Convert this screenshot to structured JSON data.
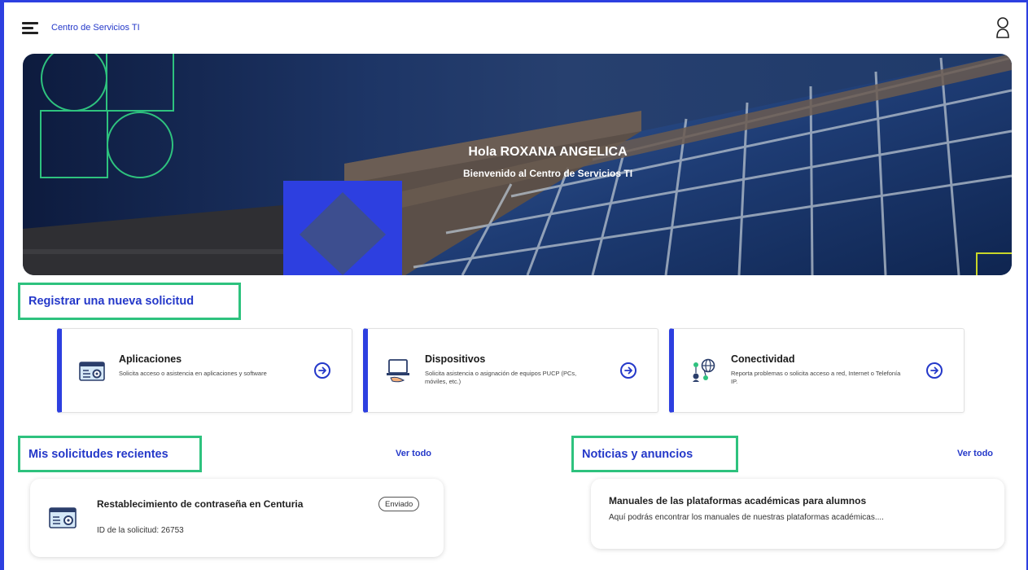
{
  "header": {
    "app_title": "Centro de Servicios TI"
  },
  "hero": {
    "greeting": "Hola ROXANA ANGELICA",
    "subtitle": "Bienvenido al Centro de Servicios TI"
  },
  "new_request": {
    "heading": "Registrar una nueva solicitud",
    "cards": [
      {
        "title": "Aplicaciones",
        "description": "Solicita acceso o asistencia en aplicaciones y software",
        "icon": "app-settings-icon"
      },
      {
        "title": "Dispositivos",
        "description": "Solicita asistencia o asignación de equipos PUCP (PCs, móviles, etc.)",
        "icon": "laptop-icon"
      },
      {
        "title": "Conectividad",
        "description": "Reporta problemas o solicita acceso a red, Internet o Telefonía IP.",
        "icon": "network-icon"
      }
    ]
  },
  "recent_requests": {
    "heading": "Mis solicitudes recientes",
    "see_all": "Ver todo",
    "items": [
      {
        "title": "Restablecimiento de contraseña en Centuria",
        "id_text": "ID de la solicitud: 26753",
        "status": "Enviado"
      }
    ]
  },
  "news": {
    "heading": "Noticias y anuncios",
    "see_all": "Ver todo",
    "items": [
      {
        "title": "Manuales de las plataformas académicas para alumnos",
        "description": "Aquí podrás encontrar los manuales de nuestras plataformas académicas...."
      }
    ]
  },
  "colors": {
    "accent_blue": "#2438c9",
    "frame_blue": "#2d3fe0",
    "highlight_green": "#2ec27e"
  }
}
